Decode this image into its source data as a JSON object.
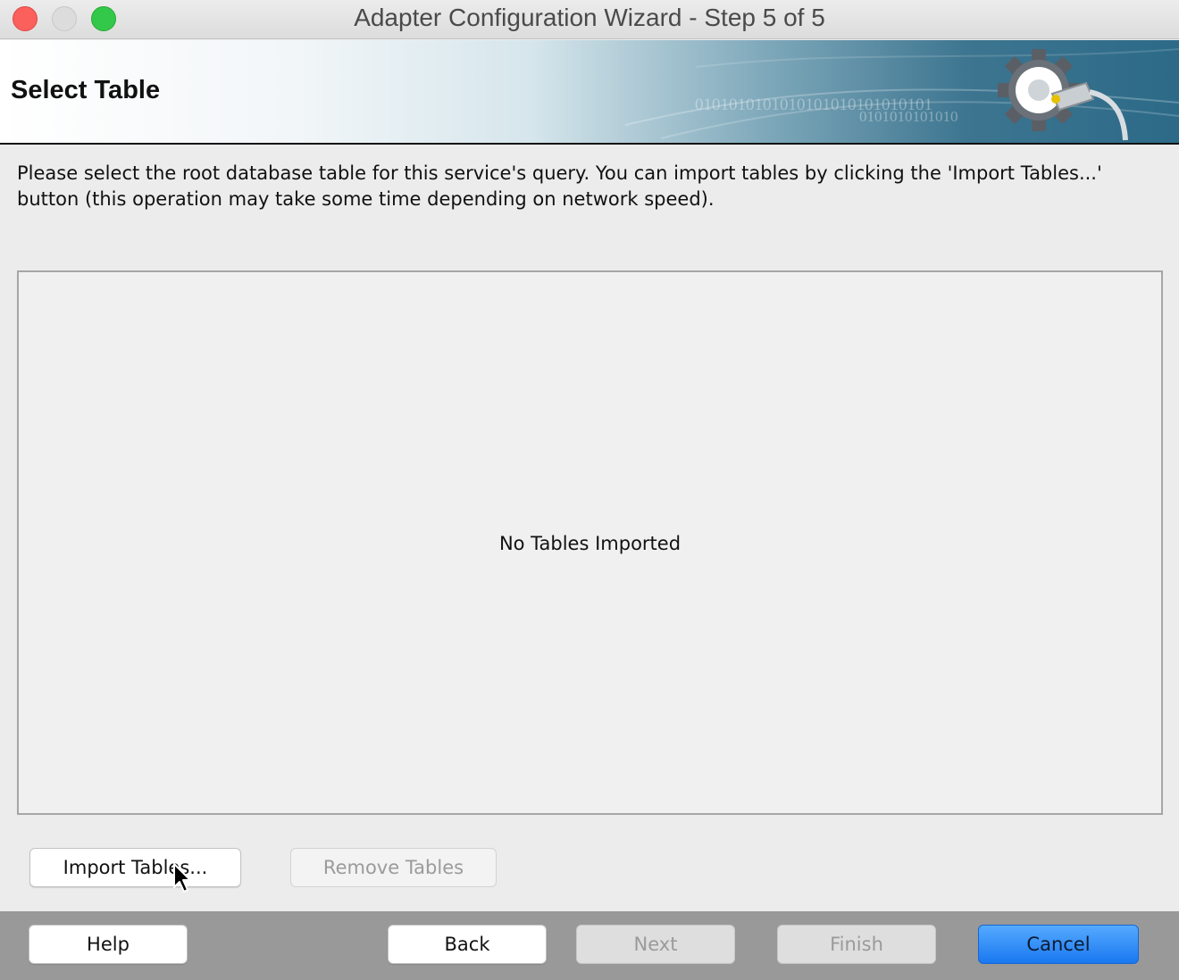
{
  "window": {
    "title": "Adapter Configuration Wizard - Step 5 of 5"
  },
  "banner": {
    "title": "Select Table",
    "binary_line_1": "0101010101010101010101010101",
    "binary_line_2": "0101010101010",
    "icon": "gear-plug-icon"
  },
  "instructions": {
    "text": "Please select the root database table for this service's query.  You can import tables by clicking the 'Import Tables...' button (this operation may take some time depending on network speed)."
  },
  "table_panel": {
    "empty_message": "No Tables Imported"
  },
  "actions": {
    "import_label": "Import Tables...",
    "remove_label": "Remove Tables"
  },
  "footer": {
    "help_label": "Help",
    "back_label": "Back",
    "next_label": "Next",
    "finish_label": "Finish",
    "cancel_label": "Cancel"
  },
  "colors": {
    "close": "#fc605c",
    "minimize": "#dcdcdc",
    "zoom": "#34c84a",
    "primary_button": "#1a78f0",
    "footer_bar": "#999999"
  }
}
